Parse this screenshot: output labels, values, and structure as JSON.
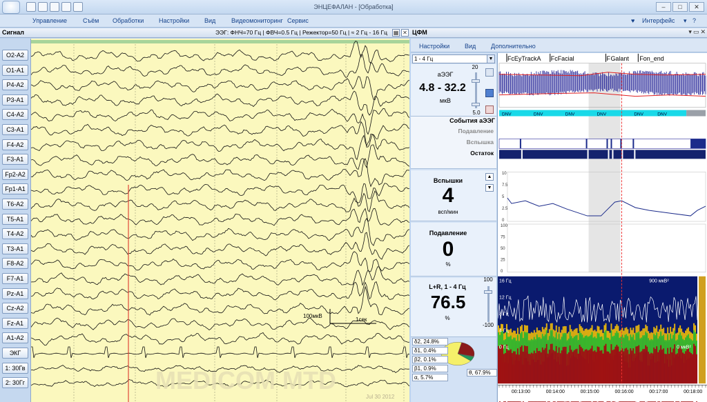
{
  "app": {
    "title": "ЭНЦЕФАЛАН - [Обработка]",
    "interface_label": "Интерфейс"
  },
  "menu": [
    "Управление",
    "Съём",
    "Обработки",
    "Настройки",
    "Вид",
    "Видеомониторинг",
    "Сервис"
  ],
  "signal_panel": {
    "title": "Сигнал",
    "params": "ЭЭГ: ФНЧ=70 Гц | ФВЧ=0.5 Гц | Режектор=50 Гц | ≈ 2 Гц - 16 Гц"
  },
  "channels": [
    "O2-A2",
    "O1-A1",
    "P4-A2",
    "P3-A1",
    "C4-A2",
    "C3-A1",
    "F4-A2",
    "F3-A1",
    "Fp2-A2",
    "Fp1-A1",
    "T6-A2",
    "T5-A1",
    "T4-A2",
    "T3-A1",
    "F8-A2",
    "F7-A1",
    "Pz-A1",
    "Cz-A2",
    "Fz-A1",
    "A1-A2",
    "ЭКГ",
    "1: 30Гв",
    "2: 30Гг"
  ],
  "scale": {
    "amplitude": "100мкВ",
    "time": "1сек"
  },
  "watermark": {
    "brand": "MEDICOM MTD",
    "date": "Jul 30 2012"
  },
  "cfm": {
    "title": "ЦФМ",
    "tabs": [
      "Настройки",
      "Вид",
      "Дополнительно"
    ],
    "range_select": "1 - 4 Гц",
    "aeeg": {
      "label": "аЭЭГ",
      "value": "4.8 - 32.2",
      "unit": "мкВ",
      "scale_top": "20",
      "scale_bottom": "5.0"
    },
    "events": {
      "header": "События аЭЭГ",
      "rows": [
        "Подавление",
        "Вспышка",
        "Остаток"
      ]
    },
    "bursts": {
      "label": "Вспышки",
      "value": "4",
      "unit": "всп/мин"
    },
    "suppression": {
      "label": "Подавление",
      "value": "0",
      "unit": "%"
    },
    "lr": {
      "label": "L+R, 1 - 4 Гц",
      "value": "76.5",
      "unit": "%",
      "scale_top": "100",
      "scale_bottom": "-100"
    },
    "pie": [
      {
        "label": "δ2, 24.8%",
        "value": 24.8,
        "color": "#8b1a1a"
      },
      {
        "label": "δ1, 0.4%",
        "value": 0.4,
        "color": "#a0a0a0"
      },
      {
        "label": "β2, 0.1%",
        "value": 0.1,
        "color": "#3b7bd4"
      },
      {
        "label": "β1, 0.9%",
        "value": 0.9,
        "color": "#5aa63a"
      },
      {
        "label": "α, 5.7%",
        "value": 5.7,
        "color": "#1f9c5a"
      },
      {
        "label": "θ, 67.9%",
        "value": 67.9,
        "color": "#f5f06a"
      }
    ],
    "markers": [
      "Fc",
      "EyTrackA",
      "Fc",
      "Facial",
      "F",
      "Galant",
      "Fon_end"
    ],
    "dnv": "DNV",
    "bursts_axis": [
      "10",
      "7.5",
      "5",
      "2.5",
      "0"
    ],
    "suppr_axis": [
      "100",
      "75",
      "50",
      "25",
      "0"
    ],
    "spec_labels": [
      "16 Гц",
      "900 мкВ²",
      "12 Гц",
      "8 Гц",
      "4 Гц",
      "0 Гц",
      "0 мкВ²"
    ],
    "time_axis": [
      "00:13:00",
      "00:14:00",
      "00:15:00",
      "00:16:00",
      "00:17:00",
      "00:18:00"
    ]
  }
}
